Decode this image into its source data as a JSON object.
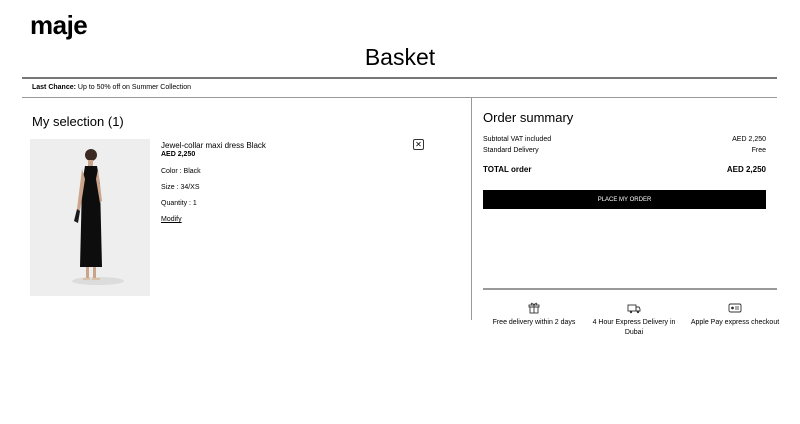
{
  "header": {
    "logo": "maje",
    "title": "Basket"
  },
  "promo": {
    "label": "Last Chance:",
    "text": "Up to 50% off on Summer Collection"
  },
  "selection": {
    "title": "My selection (1)",
    "item": {
      "name": "Jewel-collar maxi dress Black",
      "price": "AED 2,250",
      "color": "Color : Black",
      "size": "Size : 34/XS",
      "quantity": "Quantity : 1",
      "modify": "Modify",
      "remove": "✕"
    }
  },
  "summary": {
    "title": "Order summary",
    "subtotal_label": "Subtotal VAT included",
    "subtotal_value": "AED 2,250",
    "delivery_label": "Standard Delivery",
    "delivery_value": "Free",
    "total_label": "TOTAL order",
    "total_value": "AED 2,250",
    "place_order": "PLACE MY ORDER"
  },
  "benefits": [
    {
      "icon": "gift-box-icon",
      "text": "Free delivery within 2 days"
    },
    {
      "icon": "delivery-truck-icon",
      "text": "4 Hour Express Delivery in Dubai"
    },
    {
      "icon": "apple-pay-icon",
      "text": "Apple Pay express checkout"
    }
  ]
}
